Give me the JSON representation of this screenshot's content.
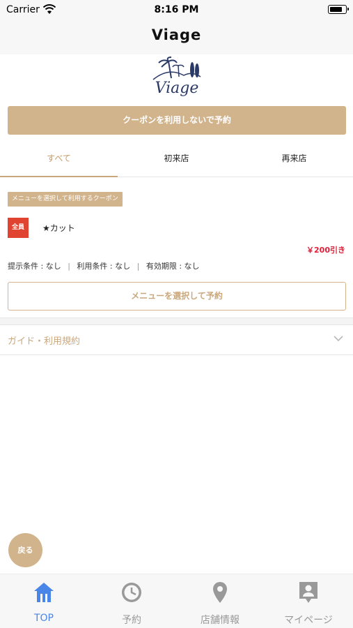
{
  "status_bar": {
    "carrier": "Carrier",
    "time": "8:16 PM"
  },
  "nav": {
    "title": "Viage"
  },
  "logo": {
    "text": "Viage"
  },
  "cta_button": "クーポンを利用しないで予約",
  "tabs": [
    {
      "label": "すべて",
      "active": true
    },
    {
      "label": "初来店",
      "active": false
    },
    {
      "label": "再来店",
      "active": false
    }
  ],
  "coupon": {
    "tag": "メニューを選択して利用するクーポン",
    "target": "全員",
    "name": "★カット",
    "discount": "￥200引き",
    "conditions": {
      "present": "提示条件 : なし",
      "use": "利用条件 : なし",
      "expiry": "有効期限 : なし",
      "separator": "|"
    },
    "select_button": "メニューを選択して予約"
  },
  "guide": {
    "label": "ガイド・利用規約"
  },
  "back_button": "戻る",
  "tab_bar": [
    {
      "label": "TOP",
      "icon": "home-icon",
      "active": true
    },
    {
      "label": "予約",
      "icon": "clock-icon",
      "active": false
    },
    {
      "label": "店舗情報",
      "icon": "location-pin-icon",
      "active": false
    },
    {
      "label": "マイページ",
      "icon": "profile-card-icon",
      "active": false
    }
  ],
  "colors": {
    "accent": "#d2b48c",
    "active_tab_text": "#c29b6a",
    "badge_red": "#e0432f",
    "discount_red": "#e0203a",
    "tabbar_active": "#4a86e8",
    "tabbar_inactive": "#999999",
    "logo_navy": "#2b3a66"
  }
}
